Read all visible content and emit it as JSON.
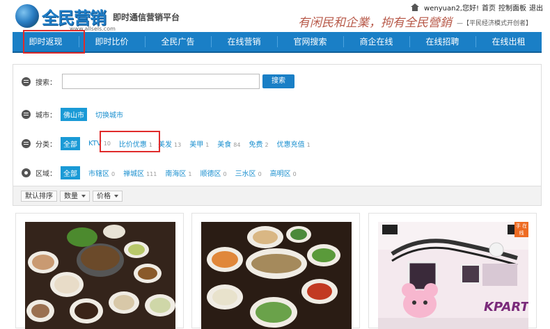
{
  "header": {
    "logo_name": "全民营销",
    "logo_sub": "即时通信营销平台",
    "logo_url": "www.allsels.com",
    "slogan": "有闲民和企業，拘有全民營銷",
    "slogan_sub": "—【平民经济模式开创者】",
    "user_greeting": "wenyuan2,您好!",
    "links": {
      "home": "首页",
      "dashboard": "控制面板",
      "logout": "退出"
    }
  },
  "nav": [
    "即时返现",
    "即时比价",
    "全民广告",
    "在线营销",
    "官网搜索",
    "商企在线",
    "在线招聘",
    "在线出租"
  ],
  "filters": {
    "search": {
      "label": "搜索：",
      "placeholder": "",
      "button": "搜索"
    },
    "city": {
      "label": "城市：",
      "selected": "佛山市",
      "switch": "切换城市"
    },
    "category": {
      "label": "分类：",
      "all": "全部",
      "options": [
        {
          "name": "KTV",
          "count": "10"
        },
        {
          "name": "比价优惠",
          "count": "1"
        },
        {
          "name": "美发",
          "count": "13"
        },
        {
          "name": "美甲",
          "count": "1"
        },
        {
          "name": "美食",
          "count": "84"
        },
        {
          "name": "免费",
          "count": "2"
        },
        {
          "name": "优惠充值",
          "count": "1"
        }
      ]
    },
    "district": {
      "label": "区域：",
      "all": "全部",
      "options": [
        {
          "name": "市辖区",
          "count": "0"
        },
        {
          "name": "禅城区",
          "count": "111"
        },
        {
          "name": "南海区",
          "count": "1"
        },
        {
          "name": "顺德区",
          "count": "0"
        },
        {
          "name": "三水区",
          "count": "0"
        },
        {
          "name": "高明区",
          "count": "0"
        }
      ]
    }
  },
  "sort": {
    "default": "默认排序",
    "quantity": "数量",
    "price": "价格"
  },
  "cards": [
    {
      "icon": "food-photo-icon"
    },
    {
      "icon": "food-photo-icon"
    },
    {
      "icon": "ktv-photo-icon",
      "tag": "手 在线",
      "logo_text": "KPARTY"
    }
  ],
  "colors": {
    "nav_blue": "#1a7fc6",
    "highlight_red": "#e02b2b",
    "chip_blue": "#1a9ad6"
  }
}
